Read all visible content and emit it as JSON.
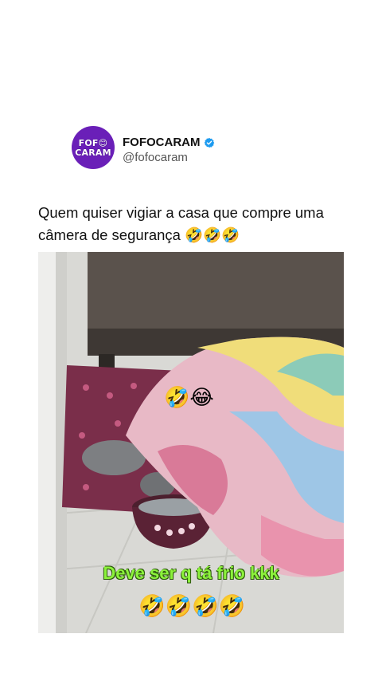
{
  "account": {
    "avatar_line1": "FOF😊",
    "avatar_line2": "CARAM",
    "name": "FOFOCARAM",
    "handle": "@fofocaram",
    "verified": true,
    "verified_color": "#1d9bf0",
    "avatar_color": "#6a1fb8"
  },
  "tweet": {
    "text": "Quem quiser vigiar a casa que compre uma câmera de segurança 🤣🤣🤣"
  },
  "media": {
    "overlay_emoji_top": "🤣😂",
    "overlay_caption": "Deve ser q tá frio kkk",
    "overlay_emoji_bottom": "🤣🤣🤣🤣",
    "caption_color": "#8cf23c"
  }
}
